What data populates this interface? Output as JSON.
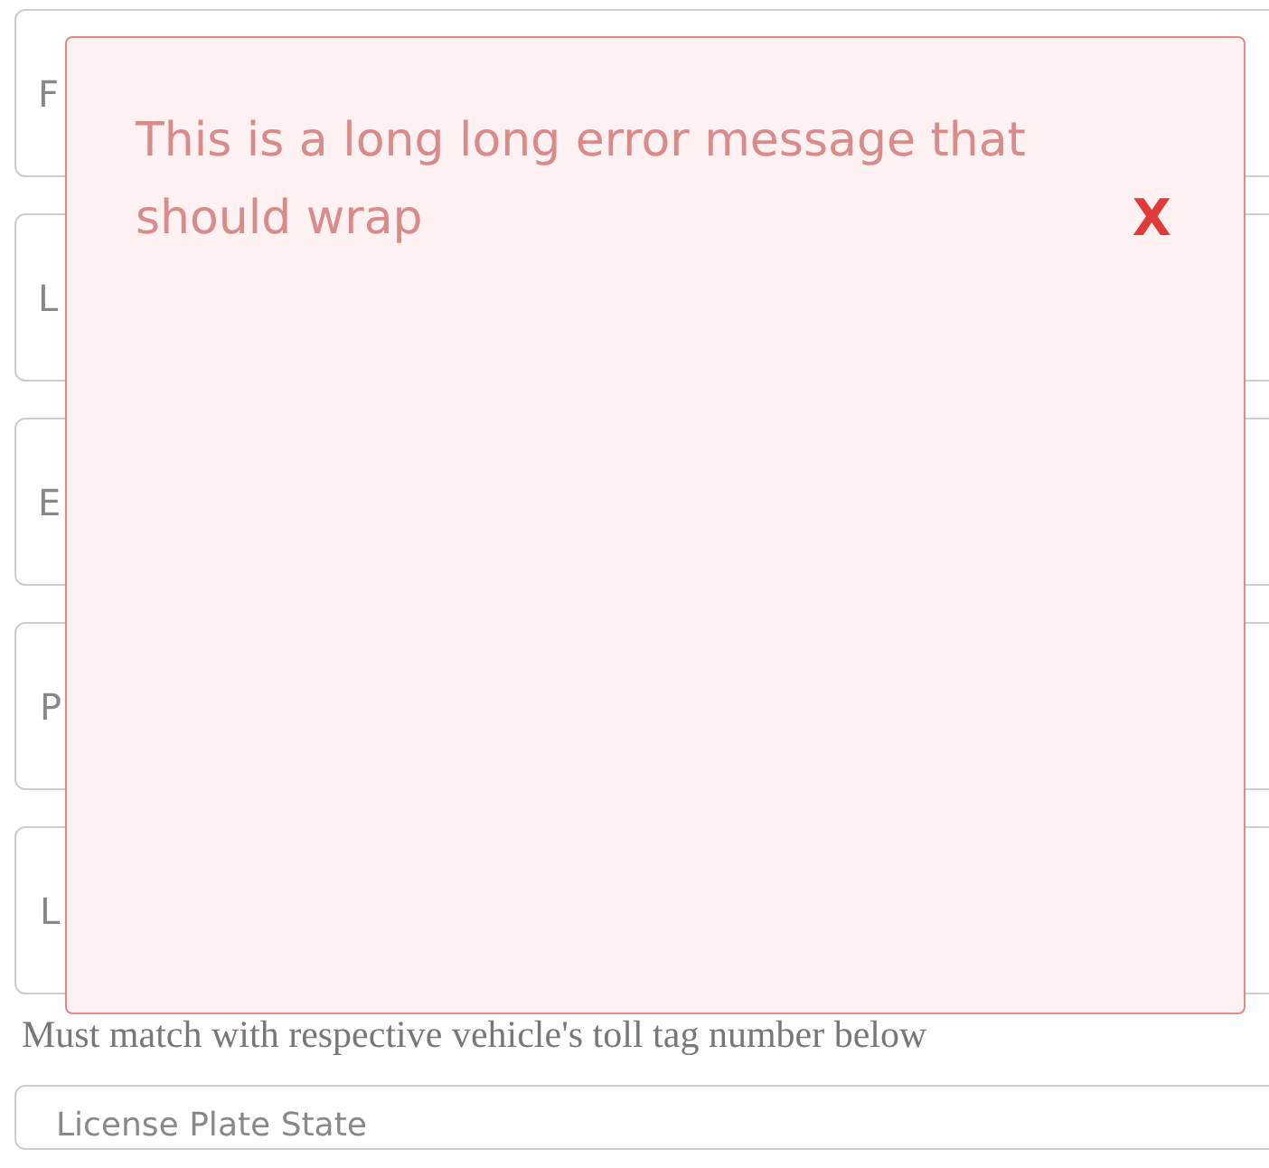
{
  "fields": [
    {
      "placeholder": "F"
    },
    {
      "placeholder": "L"
    },
    {
      "placeholder": "E"
    },
    {
      "placeholder": "P"
    },
    {
      "placeholder": "L"
    }
  ],
  "help_text": "Must match with respective vehicle's toll tag number below",
  "next_field": {
    "placeholder": "License Plate State"
  },
  "error_popup": {
    "message": "This is a long long error message that should wrap",
    "close": "X"
  }
}
